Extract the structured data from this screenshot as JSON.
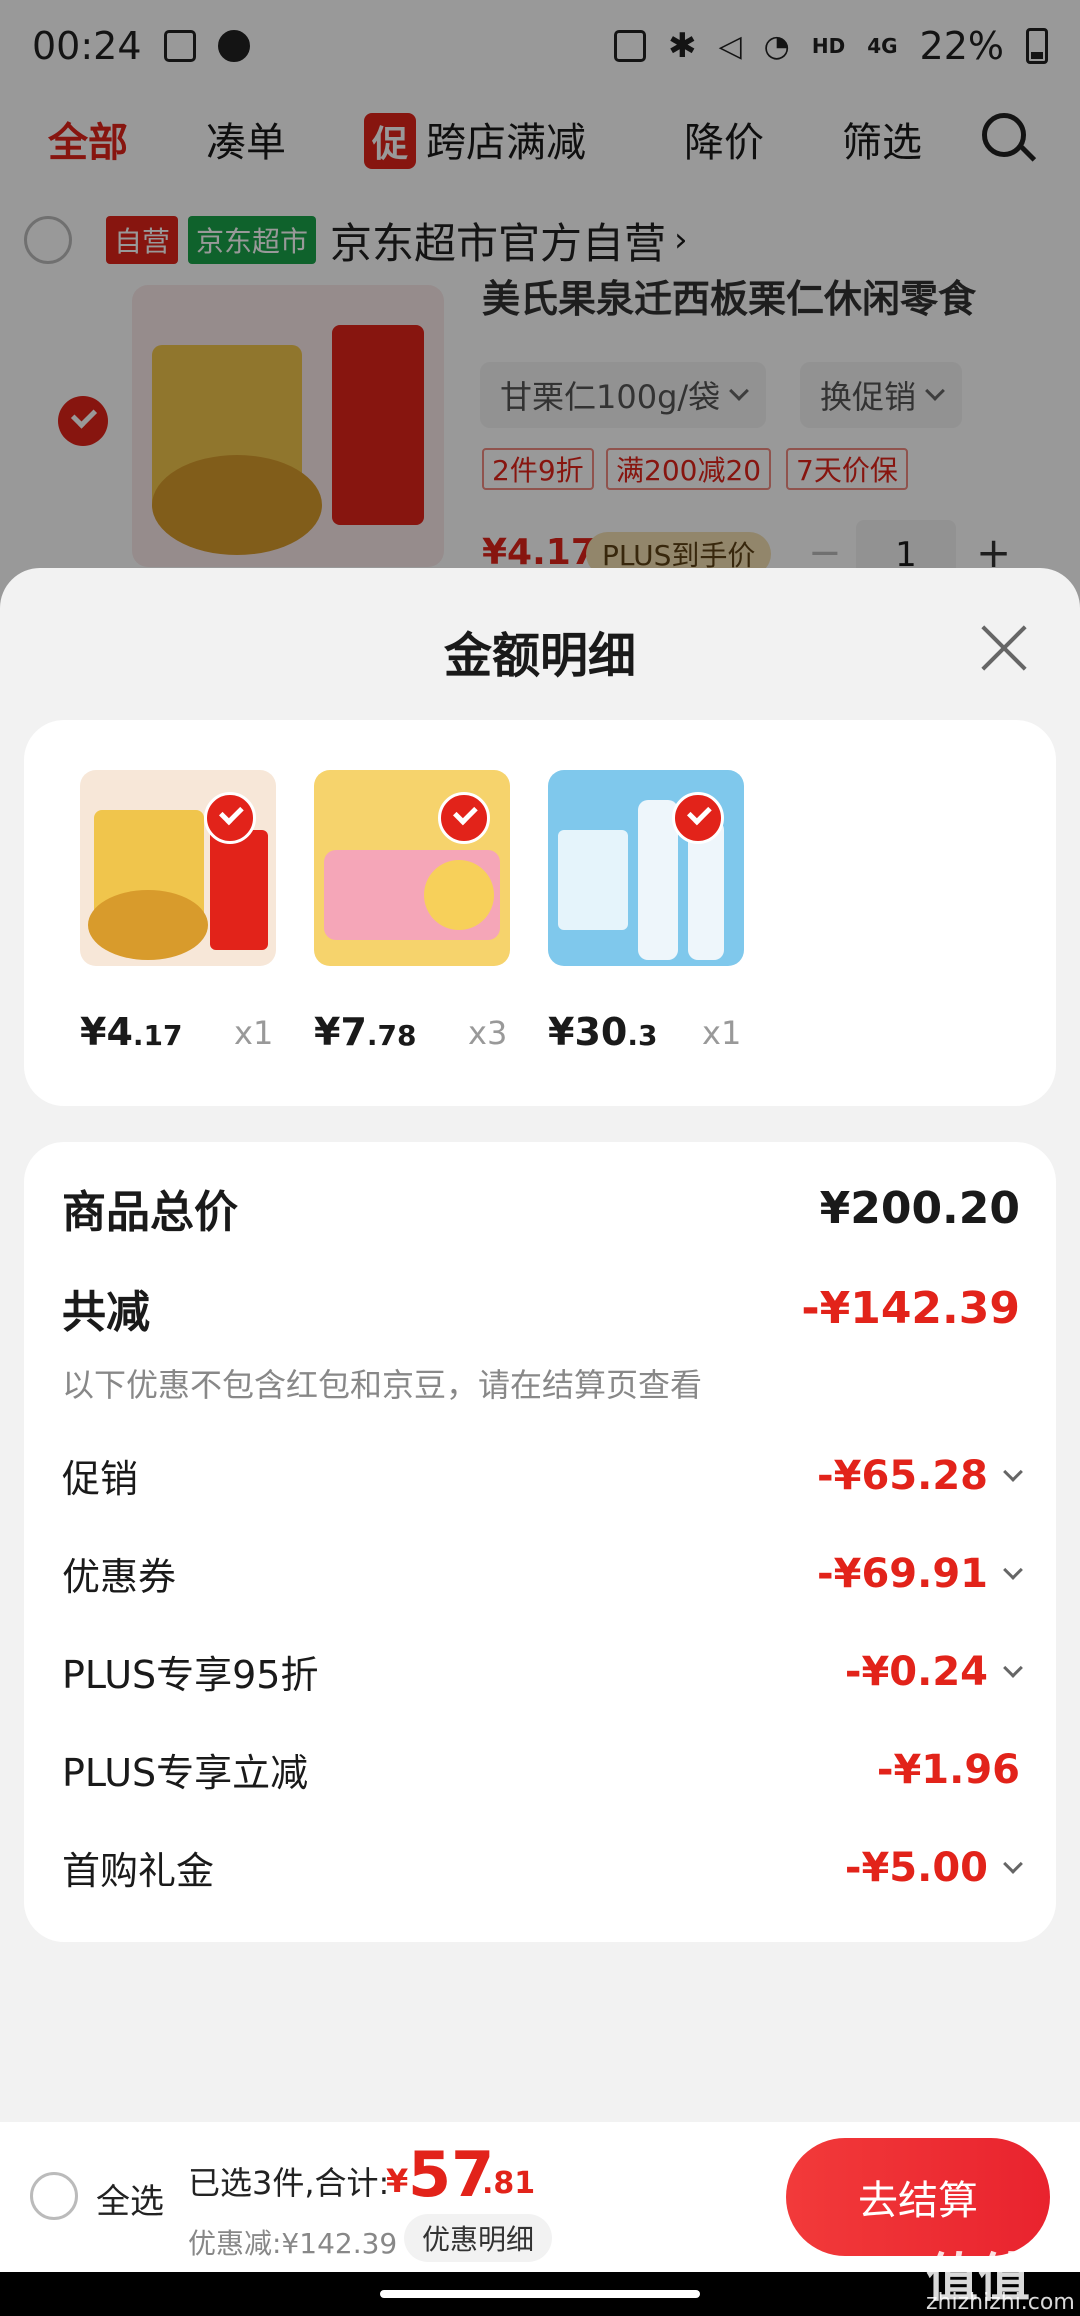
{
  "status_bar": {
    "time": "00:24",
    "network": "HD",
    "signal": "4G",
    "battery": "22%"
  },
  "tabs": [
    {
      "label": "全部",
      "active": true
    },
    {
      "label": "凑单"
    },
    {
      "label": "跨店满减",
      "badge": "促"
    },
    {
      "label": "降价"
    },
    {
      "label": "筛选"
    }
  ],
  "background_item": {
    "store_tag_1": "自营",
    "store_tag_2": "京东超市",
    "store_name": "京东超市官方自营",
    "title": "美氏果泉迁西板栗仁休闲零食",
    "spec": "甘栗仁100g/袋",
    "promo_switch": "换促销",
    "tags": [
      "2件9折",
      "满200减20",
      "7天价保"
    ],
    "price": "¥4.17",
    "plus_label": "PLUS到手价",
    "quantity": "1"
  },
  "sheet": {
    "title": "金额明细",
    "items": [
      {
        "price_int": "¥4",
        "price_dec": ".17",
        "qty": "x1",
        "thumb": "chestnut-snack-image",
        "bg": "#f7e7d8"
      },
      {
        "price_int": "¥7",
        "price_dec": ".78",
        "qty": "x3",
        "thumb": "liby-detergent-image",
        "bg": "#f6d36c"
      },
      {
        "price_int": "¥30",
        "price_dec": ".3",
        "qty": "x1",
        "thumb": "water-bottle-image",
        "bg": "#7fc8ec"
      }
    ],
    "summary": {
      "total_label": "商品总价",
      "total_value": "¥200.20",
      "reduce_label": "共减",
      "reduce_value": "-¥142.39",
      "note": "以下优惠不包含红包和京豆，请在结算页查看",
      "rows": [
        {
          "label": "促销",
          "value": "-¥65.28"
        },
        {
          "label": "优惠券",
          "value": "-¥69.91"
        },
        {
          "label": "PLUS专享95折",
          "value": "-¥0.24"
        },
        {
          "label": "PLUS专享立减",
          "value": "-¥1.96"
        },
        {
          "label": "首购礼金",
          "value": "-¥5.00"
        }
      ]
    }
  },
  "bottom_bar": {
    "select_all": "全选",
    "selected_text": "已选3件,合计:",
    "total_yen": "¥",
    "total_int": "57",
    "total_dec": ".81",
    "discount_text": "优惠减:¥142.39",
    "detail_button": "优惠明细",
    "checkout": "去结算"
  },
  "watermark": {
    "text": "值值值",
    "url": "zhizhizhi.com"
  },
  "colors": {
    "accent": "#e2231a",
    "green_tag": "#1aa34a",
    "plus_gold": "#f3dfb2"
  }
}
